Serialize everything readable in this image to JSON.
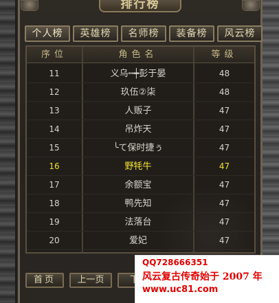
{
  "window": {
    "title": "排行榜"
  },
  "tabs": [
    {
      "label": "个人榜"
    },
    {
      "label": "英雄榜"
    },
    {
      "label": "名师榜"
    },
    {
      "label": "装备榜"
    },
    {
      "label": "风云榜"
    }
  ],
  "table": {
    "headers": {
      "rank": "序位",
      "name": "角色名",
      "level": "等级"
    },
    "rows": [
      {
        "rank": "11",
        "name": "义乌┅┿彭于晏",
        "level": "48"
      },
      {
        "rank": "12",
        "name": "玖伍②柒",
        "level": "48"
      },
      {
        "rank": "13",
        "name": "人贩子",
        "level": "47"
      },
      {
        "rank": "14",
        "name": "吊炸天",
        "level": "47"
      },
      {
        "rank": "15",
        "name": "╰て保时捷ぅ",
        "level": "47"
      },
      {
        "rank": "16",
        "name": "野牦牛",
        "level": "47"
      },
      {
        "rank": "17",
        "name": "余额宝",
        "level": "47"
      },
      {
        "rank": "18",
        "name": "鸭先知",
        "level": "47"
      },
      {
        "rank": "19",
        "name": "法落台",
        "level": "47"
      },
      {
        "rank": "20",
        "name": "爱妃",
        "level": "47"
      }
    ]
  },
  "pager": {
    "first": "首页",
    "prev": "上一页",
    "next": "下一"
  },
  "promo": {
    "qq": "QQ728666351",
    "slogan": "风云复古传奇始于 2007 年",
    "site": "www.uc81.com"
  },
  "colors": {
    "highlight_row": "#f2e030",
    "text": "#d8d4cc",
    "promo_red": "#e00000"
  }
}
